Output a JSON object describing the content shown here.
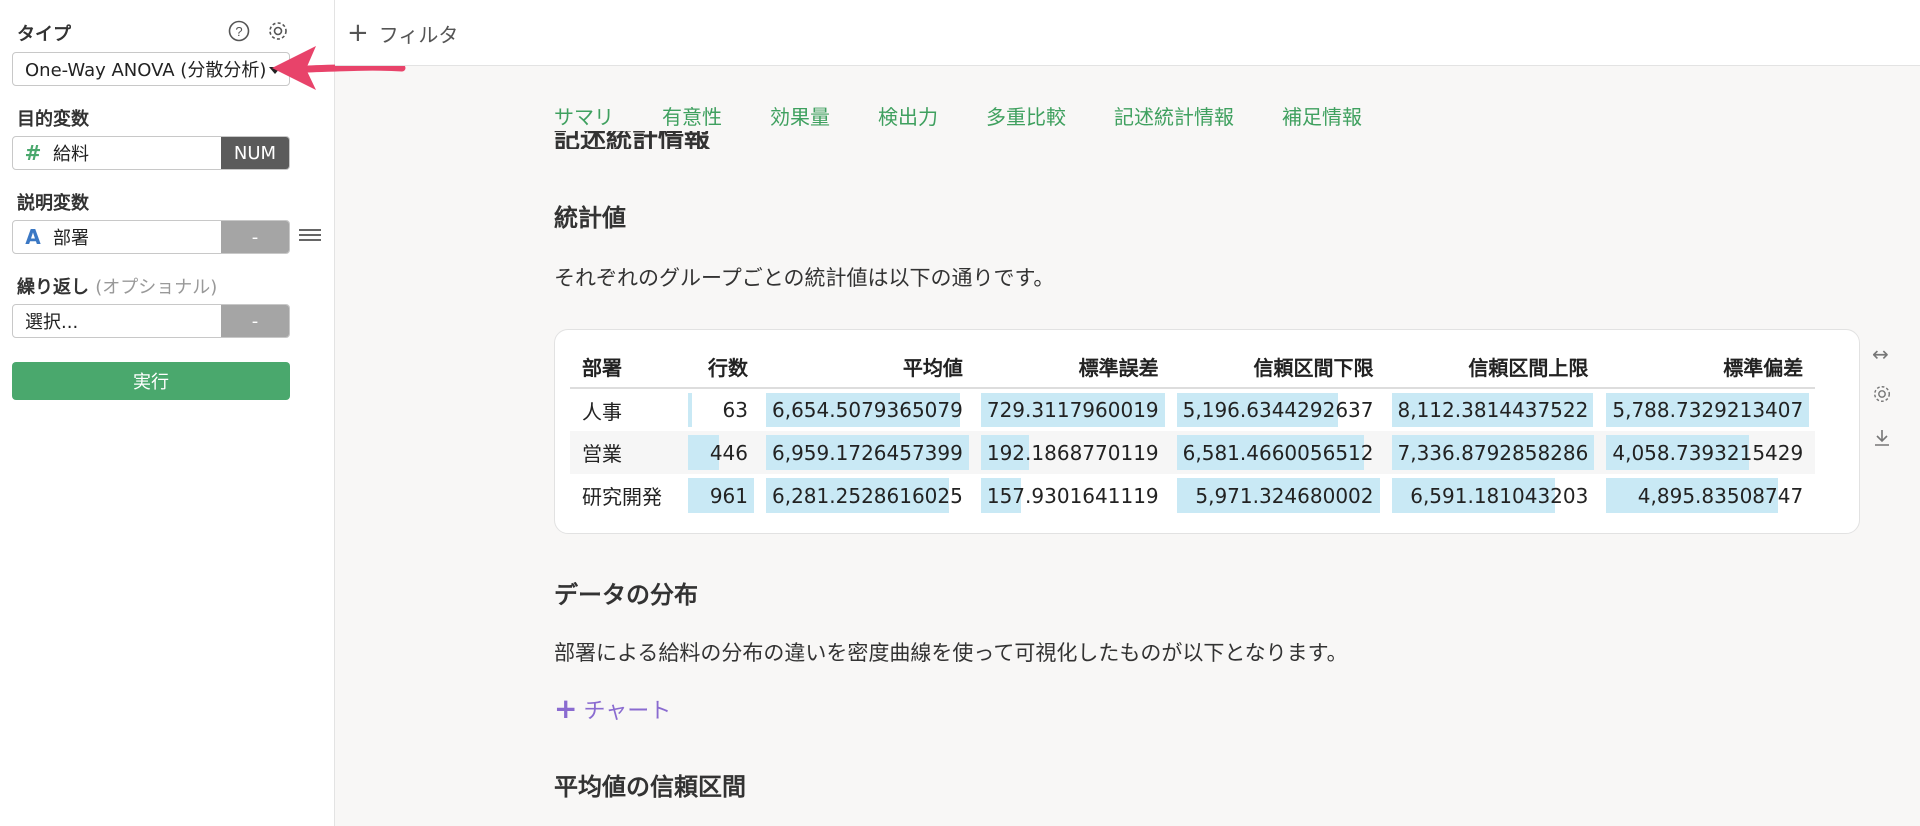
{
  "sidebar": {
    "type_label": "タイプ",
    "type_value": "One-Way ANOVA (分散分析)",
    "target_label": "目的変数",
    "target_icon": "#",
    "target_field": "給料",
    "target_tag": "NUM",
    "explain_label": "説明変数",
    "explain_icon": "A",
    "explain_field": "部署",
    "explain_tag": "-",
    "repeat_label": "繰り返し",
    "repeat_optional": "(オプショナル)",
    "repeat_placeholder": "選択...",
    "repeat_tag": "-",
    "run_button": "実行"
  },
  "topbar": {
    "filter_label": "フィルタ"
  },
  "tabs": [
    "サマリ",
    "有意性",
    "効果量",
    "検出力",
    "多重比較",
    "記述統計情報",
    "補足情報"
  ],
  "clipped_heading": "記述統計情報",
  "stats": {
    "heading": "統計値",
    "description": "それぞれのグループごとの統計値は以下の通りです。",
    "columns": [
      "部署",
      "行数",
      "平均値",
      "標準誤差",
      "信頼区間下限",
      "信頼区間上限",
      "標準偏差"
    ],
    "rows": [
      [
        "人事",
        "63",
        "6,654.5079365079",
        "729.3117960019",
        "5,196.6344292637",
        "8,112.3814437522",
        "5,788.7329213407"
      ],
      [
        "営業",
        "446",
        "6,959.1726457399",
        "192.1868770119",
        "6,581.4660056512",
        "7,336.8792858286",
        "4,058.7393215429"
      ],
      [
        "研究開発",
        "961",
        "6,281.2528616025",
        "157.9301641119",
        "5,971.324680002",
        "6,591.181043203",
        "4,895.83508747"
      ]
    ],
    "bar_fractions": [
      [
        null,
        0.066,
        0.956,
        1.0,
        0.794,
        0.994,
        1.0
      ],
      [
        null,
        0.464,
        1.0,
        0.264,
        0.925,
        1.0,
        0.701
      ],
      [
        null,
        1.0,
        0.903,
        0.217,
        1.0,
        0.807,
        0.846
      ]
    ]
  },
  "distribution": {
    "heading": "データの分布",
    "description": "部署による給料の分布の違いを密度曲線を使って可視化したものが以下となります。",
    "chart_link": "チャート"
  },
  "ci_heading": "平均値の信頼区間",
  "colors": {
    "accent_green": "#4aa86d",
    "tab_green": "#3fa05f",
    "bar_blue": "#c9e9f5",
    "chart_purple": "#8a6bd0",
    "arrow_pink": "#e8436a"
  }
}
